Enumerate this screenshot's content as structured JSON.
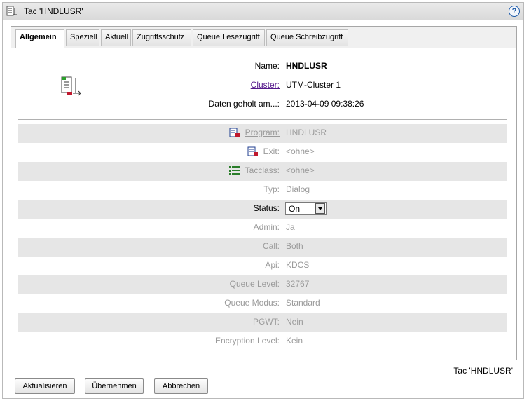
{
  "window": {
    "title": "Tac 'HNDLUSR'",
    "help_glyph": "?"
  },
  "tabs": [
    {
      "label": "Allgemein",
      "active": true
    },
    {
      "label": "Speziell"
    },
    {
      "label": "Aktuell"
    },
    {
      "label": "Zugriffsschutz"
    },
    {
      "label": "Queue Lesezugriff"
    },
    {
      "label": "Queue Schreibzugriff"
    }
  ],
  "header": {
    "name_label": "Name:",
    "name_value": "HNDLUSR",
    "cluster_label": "Cluster:",
    "cluster_value": "UTM-Cluster 1",
    "fetched_label": "Daten geholt am...:",
    "fetched_value": "2013-04-09 09:38:26"
  },
  "fields": {
    "program": {
      "label": "Program:",
      "value": "HNDLUSR"
    },
    "exit": {
      "label": "Exit:",
      "value": "<ohne>"
    },
    "tacclass": {
      "label": "Tacclass:",
      "value": "<ohne>"
    },
    "typ": {
      "label": "Typ:",
      "value": "Dialog"
    },
    "status": {
      "label": "Status:",
      "value": "On"
    },
    "admin": {
      "label": "Admin:",
      "value": "Ja"
    },
    "call": {
      "label": "Call:",
      "value": "Both"
    },
    "api": {
      "label": "Api:",
      "value": "KDCS"
    },
    "queue_level": {
      "label": "Queue Level:",
      "value": "32767"
    },
    "queue_modus": {
      "label": "Queue Modus:",
      "value": "Standard"
    },
    "pgwt": {
      "label": "PGWT:",
      "value": "Nein"
    },
    "encryption_level": {
      "label": "Encryption Level:",
      "value": "Kein"
    }
  },
  "footer": {
    "object_title": "Tac 'HNDLUSR'",
    "refresh_label": "Aktualisieren",
    "apply_label": "Übernehmen",
    "cancel_label": "Abbrechen"
  },
  "colors": {
    "shade": "#e6e6e6",
    "disabled_text": "#9a9a9a",
    "link": "#55198b"
  }
}
